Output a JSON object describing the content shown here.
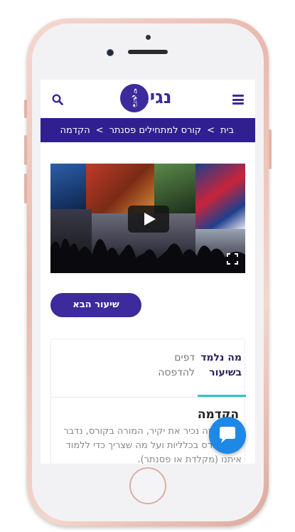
{
  "header": {
    "logo_text": "נגינה",
    "logo_symbol": "𝄞",
    "menu_icon": "hamburger-icon",
    "search_icon": "search-icon"
  },
  "breadcrumb": {
    "items": [
      "בית",
      "קורס למתחילים פסנתר",
      "הקדמה"
    ],
    "separator": ">"
  },
  "video": {
    "play_icon": "play-icon",
    "fullscreen_icon": "fullscreen-icon"
  },
  "actions": {
    "next_lesson": "שיעור הבא"
  },
  "tabs": {
    "learn": "מה נלמד בשיעור",
    "print": "דפים להדפסה"
  },
  "content": {
    "title": "הקדמה",
    "body": "בשיעור זה נכיר את יקיר, המורה בקורס, נדבר על הקורס בכלליות ועל מה שצריך כדי ללמוד איתנו (מקלדת או פסנתר)."
  },
  "colors": {
    "brand": "#3d2a9c",
    "breadcrumb_bg": "#2f1f8f",
    "tab_accent": "#2ec4c9",
    "chat": "#1e88e5"
  }
}
